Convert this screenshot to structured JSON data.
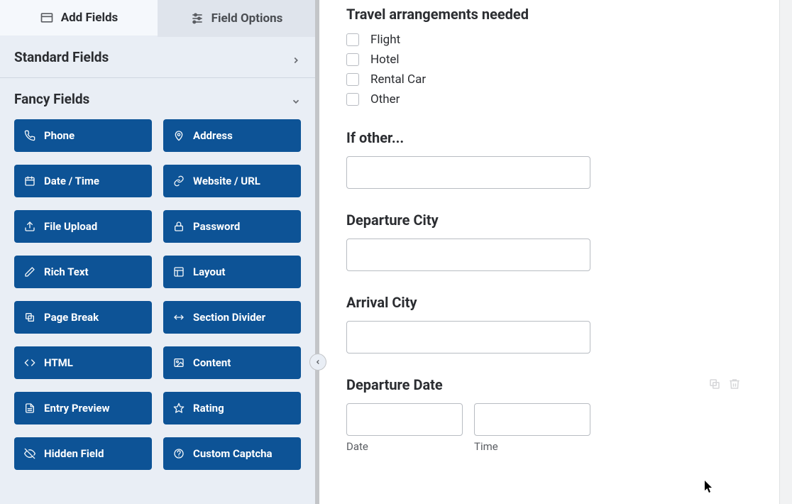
{
  "tabs": {
    "add_fields": "Add Fields",
    "field_options": "Field Options"
  },
  "sections": {
    "standard": "Standard Fields",
    "fancy": "Fancy Fields"
  },
  "fancy_fields": [
    {
      "icon": "phone",
      "label": "Phone"
    },
    {
      "icon": "pin",
      "label": "Address"
    },
    {
      "icon": "calendar",
      "label": "Date / Time"
    },
    {
      "icon": "link",
      "label": "Website / URL"
    },
    {
      "icon": "upload",
      "label": "File Upload"
    },
    {
      "icon": "lock",
      "label": "Password"
    },
    {
      "icon": "edit",
      "label": "Rich Text"
    },
    {
      "icon": "layout",
      "label": "Layout"
    },
    {
      "icon": "copy",
      "label": "Page Break"
    },
    {
      "icon": "divider",
      "label": "Section Divider"
    },
    {
      "icon": "code",
      "label": "HTML"
    },
    {
      "icon": "image",
      "label": "Content"
    },
    {
      "icon": "doc",
      "label": "Entry Preview"
    },
    {
      "icon": "star",
      "label": "Rating"
    },
    {
      "icon": "eyeoff",
      "label": "Hidden Field"
    },
    {
      "icon": "shield",
      "label": "Custom Captcha"
    }
  ],
  "form": {
    "travel_label": "Travel arrangements needed",
    "travel_options": [
      "Flight",
      "Hotel",
      "Rental Car",
      "Other"
    ],
    "if_other_label": "If other...",
    "departure_city_label": "Departure City",
    "arrival_city_label": "Arrival City",
    "departure_date_label": "Departure Date",
    "date_sub": "Date",
    "time_sub": "Time"
  }
}
